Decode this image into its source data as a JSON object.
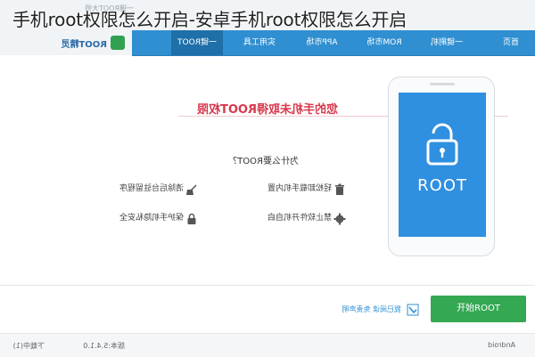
{
  "overlay_title": "手机root权限怎么开启-安卓手机root权限怎么开启",
  "app": {
    "top_left_text": "一键ROOT大师",
    "brand_text": "ROOT精灵"
  },
  "nav": {
    "items": [
      {
        "label": "首页"
      },
      {
        "label": "一键刷机"
      },
      {
        "label": "ROM市场"
      },
      {
        "label": "APP市场"
      },
      {
        "label": "实用工具"
      },
      {
        "label": "一键ROOT"
      }
    ]
  },
  "main": {
    "warning": "您的手机未取得ROOT权限",
    "why_root": "为什么要ROOT？",
    "features": [
      {
        "label": "轻松卸载手机内置",
        "icon": "trash-icon"
      },
      {
        "label": "清除后台驻留程序",
        "icon": "broom-icon"
      },
      {
        "label": "禁止软件开机自启",
        "icon": "gear-icon"
      },
      {
        "label": "保护手机隐私安全",
        "icon": "lock-icon"
      }
    ],
    "phone_screen_label": "ROOT"
  },
  "bottom": {
    "start_button": "开始ROOT",
    "agreement_text": "我已阅读 免责声明"
  },
  "status": {
    "left": "Android",
    "center": "版本:5.4.1.0",
    "right": "下载中(1)"
  },
  "colors": {
    "nav_blue": "#2f8fd1",
    "warning_red": "#d8384b",
    "button_green": "#34a852",
    "screen_blue": "#2f8fe0"
  }
}
